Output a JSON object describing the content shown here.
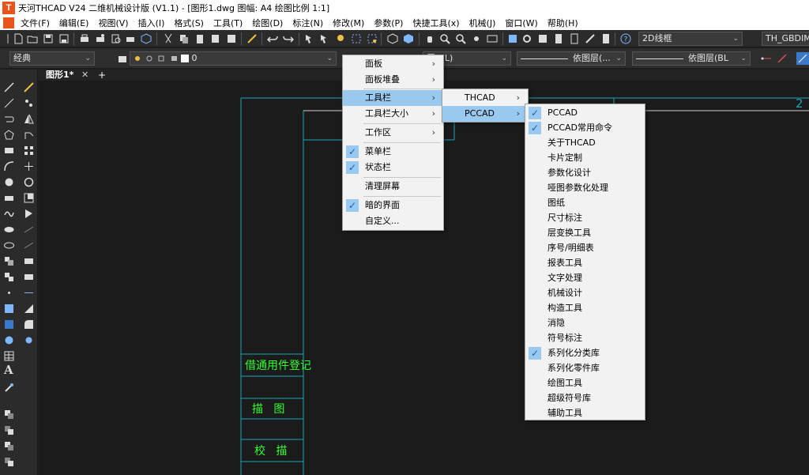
{
  "window": {
    "app_logo": "T",
    "title": "天河THCAD V24 二维机械设计版 (V1.1) - [图形1.dwg 图幅: A4 绘图比例 1:1]"
  },
  "menubar": {
    "items": [
      "文件(F)",
      "编辑(E)",
      "视图(V)",
      "插入(I)",
      "格式(S)",
      "工具(T)",
      "绘图(D)",
      "标注(N)",
      "修改(M)",
      "参数(P)",
      "快捷工具(x)",
      "机械(J)",
      "窗口(W)",
      "帮助(H)"
    ]
  },
  "toolbar1": {
    "visual_style_combo": "2D线框",
    "dimstyle_combo": "TH_GBDIM"
  },
  "toolbar2": {
    "workspace_combo": "经典",
    "layer_combo": "0",
    "color_combo": "层(BL)",
    "linetype_combo": "依图层(...",
    "lineweight_combo": "依图层(BL"
  },
  "tabs": {
    "drawing_tab": "图形1*",
    "close_glyph": "✕",
    "add_glyph": "+"
  },
  "drawing": {
    "frame_number": "2",
    "row1": "借通用件登记",
    "row2": "描   图",
    "row3": "校   描"
  },
  "menu_main": {
    "items": [
      {
        "label": "面板",
        "submenu": true,
        "checked": false,
        "highlight": false
      },
      {
        "label": "面板堆叠",
        "submenu": true,
        "checked": false,
        "highlight": false
      },
      {
        "label": "工具栏",
        "submenu": true,
        "checked": false,
        "highlight": true
      },
      {
        "label": "工具栏大小",
        "submenu": true,
        "checked": false,
        "highlight": false
      },
      {
        "label": "工作区",
        "submenu": true,
        "checked": false,
        "highlight": false
      },
      {
        "label": "菜单栏",
        "submenu": false,
        "checked": true,
        "highlight": false
      },
      {
        "label": "状态栏",
        "submenu": false,
        "checked": true,
        "highlight": false
      },
      {
        "label": "清理屏幕",
        "submenu": false,
        "checked": false,
        "highlight": false
      },
      {
        "label": "暗的界面",
        "submenu": false,
        "checked": true,
        "highlight": false
      },
      {
        "label": "自定义...",
        "submenu": false,
        "checked": false,
        "highlight": false
      }
    ]
  },
  "menu_toolbar": {
    "items": [
      {
        "label": "THCAD",
        "submenu": true,
        "highlight": false
      },
      {
        "label": "PCCAD",
        "submenu": true,
        "highlight": true
      }
    ]
  },
  "menu_pccad": {
    "items": [
      {
        "label": "PCCAD",
        "checked": true
      },
      {
        "label": "PCCAD常用命令",
        "checked": true
      },
      {
        "label": "关于THCAD",
        "checked": false
      },
      {
        "label": "卡片定制",
        "checked": false
      },
      {
        "label": "参数化设计",
        "checked": false
      },
      {
        "label": "哑图参数化处理",
        "checked": false
      },
      {
        "label": "图纸",
        "checked": false
      },
      {
        "label": "尺寸标注",
        "checked": false
      },
      {
        "label": "层变换工具",
        "checked": false
      },
      {
        "label": "序号/明细表",
        "checked": false
      },
      {
        "label": "报表工具",
        "checked": false
      },
      {
        "label": "文字处理",
        "checked": false
      },
      {
        "label": "机械设计",
        "checked": false
      },
      {
        "label": "构造工具",
        "checked": false
      },
      {
        "label": "消隐",
        "checked": false
      },
      {
        "label": "符号标注",
        "checked": false
      },
      {
        "label": "系列化分类库",
        "checked": true
      },
      {
        "label": "系列化零件库",
        "checked": false
      },
      {
        "label": "绘图工具",
        "checked": false
      },
      {
        "label": "超级符号库",
        "checked": false
      },
      {
        "label": "辅助工具",
        "checked": false
      }
    ]
  },
  "glyphs": {
    "check": "✓",
    "chevron": "›",
    "combo_arrow": "⌄",
    "text_tool": "A"
  },
  "colors": {
    "accent_orange": "#e8541c",
    "menu_highlight": "#99c9ef",
    "drawing_cyan": "#1aa6b7",
    "drawing_green": "#33ff33",
    "canvas_bg": "#1b1b1b"
  }
}
